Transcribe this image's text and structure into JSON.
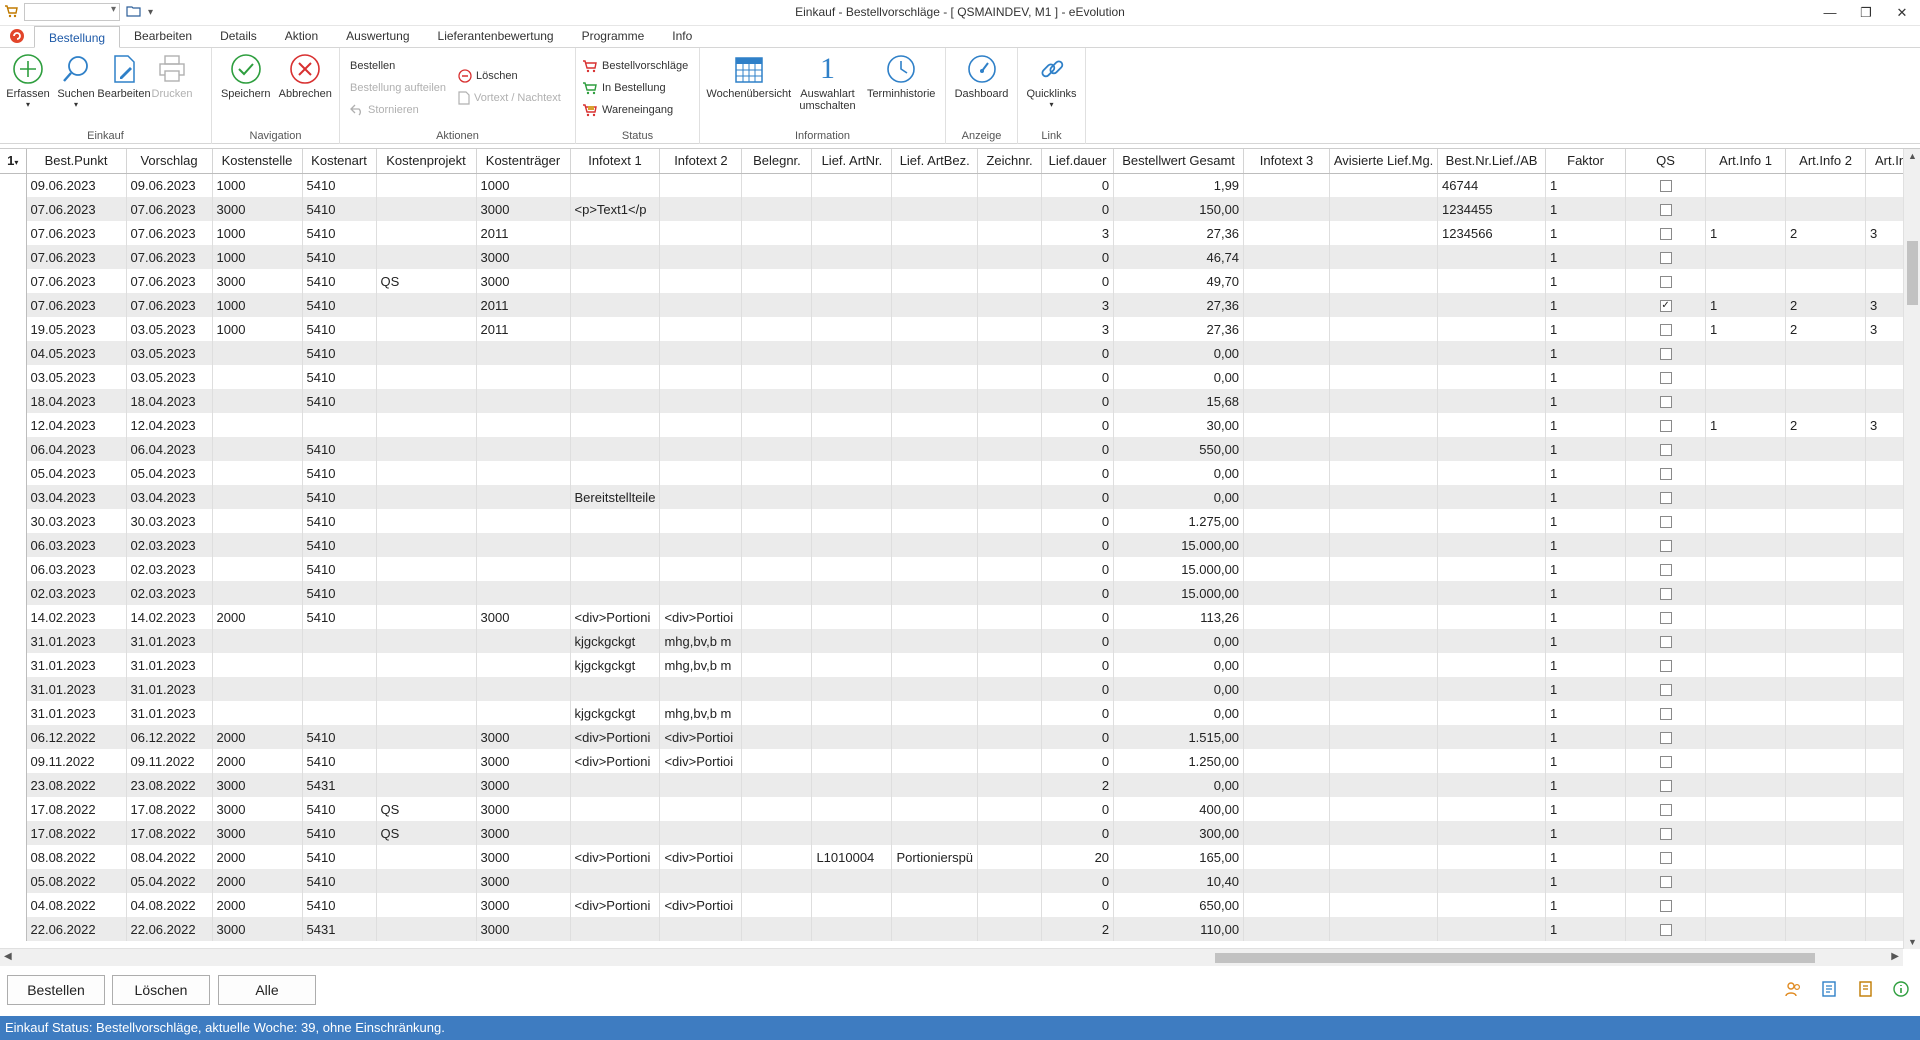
{
  "window": {
    "title": "Einkauf - Bestellvorschläge - [ QSMAINDEV, M1 ]  -  eEvolution",
    "controls": [
      "—",
      "❐",
      "✕"
    ]
  },
  "tabs": [
    "Bestellung",
    "Bearbeiten",
    "Details",
    "Aktion",
    "Auswertung",
    "Lieferantenbewertung",
    "Programme",
    "Info"
  ],
  "ribbon": {
    "einkauf": {
      "label": "Einkauf",
      "erfassen": "Erfassen",
      "suchen": "Suchen",
      "bearbeiten": "Bearbeiten",
      "drucken": "Drucken"
    },
    "navigation": {
      "label": "Navigation",
      "speichern": "Speichern",
      "abbrechen": "Abbrechen"
    },
    "aktionen": {
      "label": "Aktionen",
      "bestellen": "Bestellen",
      "bestellung_aufteilen": "Bestellung aufteilen",
      "stornieren": "Stornieren",
      "loeschen": "Löschen",
      "vortext": "Vortext / Nachtext"
    },
    "status": {
      "label": "Status",
      "bestellvorschlaege": "Bestellvorschläge",
      "in_bestellung": "In Bestellung",
      "wareneingang": "Wareneingang"
    },
    "information": {
      "label": "Information",
      "wochenuebersicht": "Wochenübersicht",
      "auswahlart_1": "Auswahlart",
      "auswahlart_2": "umschalten",
      "auswahlart_num": "1",
      "terminhistorie": "Terminhistorie"
    },
    "anzeige": {
      "label": "Anzeige",
      "dashboard": "Dashboard"
    },
    "link": {
      "label": "Link",
      "quicklinks": "Quicklinks"
    }
  },
  "grid": {
    "sort_indicator": "1",
    "columns": [
      "Best.Punkt",
      "Vorschlag",
      "Kostenstelle",
      "Kostenart",
      "Kostenprojekt",
      "Kostenträger",
      "Infotext 1",
      "Infotext 2",
      "Belegnr.",
      "Lief. ArtNr.",
      "Lief. ArtBez.",
      "Zeichnr.",
      "Lief.dauer",
      "Bestellwert Gesamt",
      "Infotext 3",
      "Avisierte Lief.Mg.",
      "Best.Nr.Lief./AB",
      "Faktor",
      "QS",
      "Art.Info 1",
      "Art.Info 2",
      "Art.In"
    ],
    "rows": [
      [
        "09.06.2023",
        "09.06.2023",
        "1000",
        "5410",
        "",
        "1000",
        "",
        "",
        "",
        "",
        "",
        "",
        "0",
        "1,99",
        "",
        "",
        "46744",
        "1",
        false,
        "",
        "",
        ""
      ],
      [
        "07.06.2023",
        "07.06.2023",
        "3000",
        "5410",
        "",
        "3000",
        "<p>Text1</p",
        "",
        "",
        "",
        "",
        "",
        "0",
        "150,00",
        "",
        "",
        "1234455",
        "1",
        false,
        "",
        "",
        ""
      ],
      [
        "07.06.2023",
        "07.06.2023",
        "1000",
        "5410",
        "",
        "2011",
        "",
        "",
        "",
        "",
        "",
        "",
        "3",
        "27,36",
        "",
        "",
        "1234566",
        "1",
        false,
        "1",
        "2",
        "3"
      ],
      [
        "07.06.2023",
        "07.06.2023",
        "1000",
        "5410",
        "",
        "3000",
        "",
        "",
        "",
        "",
        "",
        "",
        "0",
        "46,74",
        "",
        "",
        "",
        "1",
        false,
        "",
        "",
        ""
      ],
      [
        "07.06.2023",
        "07.06.2023",
        "3000",
        "5410",
        "QS",
        "3000",
        "",
        "",
        "",
        "",
        "",
        "",
        "0",
        "49,70",
        "",
        "",
        "",
        "1",
        false,
        "",
        "",
        ""
      ],
      [
        "07.06.2023",
        "07.06.2023",
        "1000",
        "5410",
        "",
        "2011",
        "",
        "",
        "",
        "",
        "",
        "",
        "3",
        "27,36",
        "",
        "",
        "",
        "1",
        true,
        "1",
        "2",
        "3"
      ],
      [
        "19.05.2023",
        "03.05.2023",
        "1000",
        "5410",
        "",
        "2011",
        "",
        "",
        "",
        "",
        "",
        "",
        "3",
        "27,36",
        "",
        "",
        "",
        "1",
        false,
        "1",
        "2",
        "3"
      ],
      [
        "04.05.2023",
        "03.05.2023",
        "",
        "5410",
        "",
        "",
        "",
        "",
        "",
        "",
        "",
        "",
        "0",
        "0,00",
        "",
        "",
        "",
        "1",
        false,
        "",
        "",
        ""
      ],
      [
        "03.05.2023",
        "03.05.2023",
        "",
        "5410",
        "",
        "",
        "",
        "",
        "",
        "",
        "",
        "",
        "0",
        "0,00",
        "",
        "",
        "",
        "1",
        false,
        "",
        "",
        ""
      ],
      [
        "18.04.2023",
        "18.04.2023",
        "",
        "5410",
        "",
        "",
        "",
        "",
        "",
        "",
        "",
        "",
        "0",
        "15,68",
        "",
        "",
        "",
        "1",
        false,
        "",
        "",
        ""
      ],
      [
        "12.04.2023",
        "12.04.2023",
        "",
        "",
        "",
        "",
        "",
        "",
        "",
        "",
        "",
        "",
        "0",
        "30,00",
        "",
        "",
        "",
        "1",
        false,
        "1",
        "2",
        "3"
      ],
      [
        "06.04.2023",
        "06.04.2023",
        "",
        "5410",
        "",
        "",
        "",
        "",
        "",
        "",
        "",
        "",
        "0",
        "550,00",
        "",
        "",
        "",
        "1",
        false,
        "",
        "",
        ""
      ],
      [
        "05.04.2023",
        "05.04.2023",
        "",
        "5410",
        "",
        "",
        "",
        "",
        "",
        "",
        "",
        "",
        "0",
        "0,00",
        "",
        "",
        "",
        "1",
        false,
        "",
        "",
        ""
      ],
      [
        "03.04.2023",
        "03.04.2023",
        "",
        "5410",
        "",
        "",
        "Bereitstellteile",
        "",
        "",
        "",
        "",
        "",
        "0",
        "0,00",
        "",
        "",
        "",
        "1",
        false,
        "",
        "",
        ""
      ],
      [
        "30.03.2023",
        "30.03.2023",
        "",
        "5410",
        "",
        "",
        "",
        "",
        "",
        "",
        "",
        "",
        "0",
        "1.275,00",
        "",
        "",
        "",
        "1",
        false,
        "",
        "",
        ""
      ],
      [
        "06.03.2023",
        "02.03.2023",
        "",
        "5410",
        "",
        "",
        "",
        "",
        "",
        "",
        "",
        "",
        "0",
        "15.000,00",
        "",
        "",
        "",
        "1",
        false,
        "",
        "",
        ""
      ],
      [
        "06.03.2023",
        "02.03.2023",
        "",
        "5410",
        "",
        "",
        "",
        "",
        "",
        "",
        "",
        "",
        "0",
        "15.000,00",
        "",
        "",
        "",
        "1",
        false,
        "",
        "",
        ""
      ],
      [
        "02.03.2023",
        "02.03.2023",
        "",
        "5410",
        "",
        "",
        "",
        "",
        "",
        "",
        "",
        "",
        "0",
        "15.000,00",
        "",
        "",
        "",
        "1",
        false,
        "",
        "",
        ""
      ],
      [
        "14.02.2023",
        "14.02.2023",
        "2000",
        "5410",
        "",
        "3000",
        "<div>Portioni",
        "<div>Portioi",
        "",
        "",
        "",
        "",
        "0",
        "113,26",
        "",
        "",
        "",
        "1",
        false,
        "",
        "",
        ""
      ],
      [
        "31.01.2023",
        "31.01.2023",
        "",
        "",
        "",
        "",
        "kjgckgckgt",
        "mhg,bv,b m",
        "",
        "",
        "",
        "",
        "0",
        "0,00",
        "",
        "",
        "",
        "1",
        false,
        "",
        "",
        ""
      ],
      [
        "31.01.2023",
        "31.01.2023",
        "",
        "",
        "",
        "",
        "kjgckgckgt",
        "mhg,bv,b m",
        "",
        "",
        "",
        "",
        "0",
        "0,00",
        "",
        "",
        "",
        "1",
        false,
        "",
        "",
        ""
      ],
      [
        "31.01.2023",
        "31.01.2023",
        "",
        "",
        "",
        "",
        "",
        "",
        "",
        "",
        "",
        "",
        "0",
        "0,00",
        "",
        "",
        "",
        "1",
        false,
        "",
        "",
        ""
      ],
      [
        "31.01.2023",
        "31.01.2023",
        "",
        "",
        "",
        "",
        "kjgckgckgt",
        "mhg,bv,b m",
        "",
        "",
        "",
        "",
        "0",
        "0,00",
        "",
        "",
        "",
        "1",
        false,
        "",
        "",
        ""
      ],
      [
        "06.12.2022",
        "06.12.2022",
        "2000",
        "5410",
        "",
        "3000",
        "<div>Portioni",
        "<div>Portioi",
        "",
        "",
        "",
        "",
        "0",
        "1.515,00",
        "",
        "",
        "",
        "1",
        false,
        "",
        "",
        ""
      ],
      [
        "09.11.2022",
        "09.11.2022",
        "2000",
        "5410",
        "",
        "3000",
        "<div>Portioni",
        "<div>Portioi",
        "",
        "",
        "",
        "",
        "0",
        "1.250,00",
        "",
        "",
        "",
        "1",
        false,
        "",
        "",
        ""
      ],
      [
        "23.08.2022",
        "23.08.2022",
        "3000",
        "5431",
        "",
        "3000",
        "",
        "",
        "",
        "",
        "",
        "",
        "2",
        "0,00",
        "",
        "",
        "",
        "1",
        false,
        "",
        "",
        ""
      ],
      [
        "17.08.2022",
        "17.08.2022",
        "3000",
        "5410",
        "QS",
        "3000",
        "",
        "",
        "",
        "",
        "",
        "",
        "0",
        "400,00",
        "",
        "",
        "",
        "1",
        false,
        "",
        "",
        ""
      ],
      [
        "17.08.2022",
        "17.08.2022",
        "3000",
        "5410",
        "QS",
        "3000",
        "",
        "",
        "",
        "",
        "",
        "",
        "0",
        "300,00",
        "",
        "",
        "",
        "1",
        false,
        "",
        "",
        ""
      ],
      [
        "08.08.2022",
        "08.04.2022",
        "2000",
        "5410",
        "",
        "3000",
        "<div>Portioni",
        "<div>Portioi",
        "",
        "L1010004",
        "Portionierspü",
        "",
        "20",
        "165,00",
        "",
        "",
        "",
        "1",
        false,
        "",
        "",
        ""
      ],
      [
        "05.08.2022",
        "05.04.2022",
        "2000",
        "5410",
        "",
        "3000",
        "",
        "",
        "",
        "",
        "",
        "",
        "0",
        "10,40",
        "",
        "",
        "",
        "1",
        false,
        "",
        "",
        ""
      ],
      [
        "04.08.2022",
        "04.08.2022",
        "2000",
        "5410",
        "",
        "3000",
        "<div>Portioni",
        "<div>Portioi",
        "",
        "",
        "",
        "",
        "0",
        "650,00",
        "",
        "",
        "",
        "1",
        false,
        "",
        "",
        ""
      ],
      [
        "22.06.2022",
        "22.06.2022",
        "3000",
        "5431",
        "",
        "3000",
        "",
        "",
        "",
        "",
        "",
        "",
        "2",
        "110,00",
        "",
        "",
        "",
        "1",
        false,
        "",
        "",
        ""
      ]
    ]
  },
  "actions": {
    "bestellen": "Bestellen",
    "loeschen": "Löschen",
    "alle": "Alle"
  },
  "status_bar": "Einkauf Status: Bestellvorschläge, aktuelle Woche: 39, ohne Einschränkung."
}
